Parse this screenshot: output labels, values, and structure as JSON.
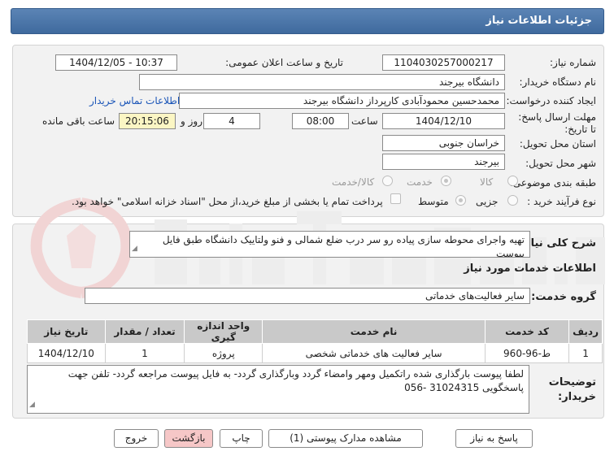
{
  "header": {
    "title": "جزئیات اطلاعات نیاز"
  },
  "form": {
    "need_number_label": "شماره نیاز:",
    "need_number": "1104030257000217",
    "announce_label": "تاریخ و ساعت اعلان عمومی:",
    "announce_value": "1404/12/05 - 10:37",
    "buyer_org_label": "نام دستگاه خریدار:",
    "buyer_org": "دانشگاه بیرجند",
    "creator_label": "ایجاد کننده درخواست:",
    "creator": "محمدحسین محمودآبادی کارپرداز دانشگاه بیرجند",
    "contact_link": "اطلاعات تماس خریدار",
    "deadline_label": "مهلت ارسال پاسخ: تا تاریخ:",
    "deadline_date": "1404/12/10",
    "time_label": "ساعت",
    "deadline_time": "08:00",
    "days_value": "4",
    "days_label": "روز و",
    "remaining_time": "20:15:06",
    "remaining_label": "ساعت باقی مانده",
    "province_label": "استان محل تحویل:",
    "province": "خراسان جنوبی",
    "city_label": "شهر محل تحویل:",
    "city": "بیرجند",
    "category_label": "طبقه بندی موضوعی:",
    "category_options": [
      "کالا",
      "خدمت",
      "کالا/خدمت"
    ],
    "process_label": "نوع فرآیند خرید :",
    "process_options": [
      "جزیی",
      "متوسط"
    ],
    "payment_note": "پرداخت تمام یا بخشی از مبلغ خرید،از محل \"اسناد خزانه اسلامی\" خواهد بود."
  },
  "details": {
    "summary_label": "شرح کلی نیاز:",
    "summary": "تهیه واجرای محوطه سازی پیاده رو سر درب ضلع شمالی و فنو ولتاییک دانشگاه طبق فایل پیوست",
    "services_heading": "اطلاعات خدمات مورد نیاز",
    "service_group_label": "گروه خدمت:",
    "service_group": "سایر فعالیت‌های خدماتی",
    "table": {
      "headers": [
        "ردیف",
        "کد خدمت",
        "نام خدمت",
        "واحد اندازه گیری",
        "تعداد / مقدار",
        "تاریخ نیاز"
      ],
      "rows": [
        [
          "1",
          "ط-96-960",
          "سایر فعالیت های خدماتی شخصی",
          "پروژه",
          "1",
          "1404/12/10"
        ]
      ]
    },
    "buyer_notes_label": "توضیحات خریدار:",
    "buyer_notes": "لطفا پیوست بارگذاری شده راتکمیل ومهر وامضاء گردد وبارگذاری گردد- به فایل پیوست مراجعه گردد- تلفن جهت پاسخگویی 31024315 -056"
  },
  "buttons": {
    "reply": "پاسخ به نیاز",
    "attachments": "مشاهده مدارک پیوستی (1)",
    "print": "چاپ",
    "back": "بازگشت",
    "exit": "خروج"
  },
  "colors": {
    "header_bg": "#4a76a8",
    "panel_bg": "#f2f2f2",
    "exit_bg": "#f6c7c7",
    "link": "#1a55b8"
  }
}
